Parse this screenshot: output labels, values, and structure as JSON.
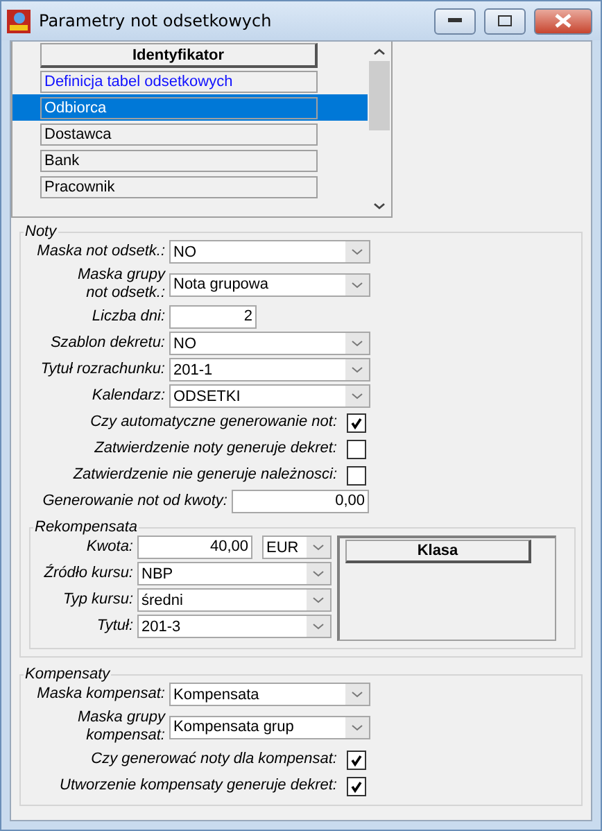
{
  "window": {
    "title": "Parametry not odsetkowych"
  },
  "list": {
    "header": "Identyfikator",
    "rows": [
      {
        "label": "Definicja tabel odsetkowych",
        "selected": false,
        "link": true
      },
      {
        "label": "Odbiorca",
        "selected": true,
        "link": false
      },
      {
        "label": "Dostawca",
        "selected": false,
        "link": false
      },
      {
        "label": "Bank",
        "selected": false,
        "link": false
      },
      {
        "label": "Pracownik",
        "selected": false,
        "link": false
      }
    ]
  },
  "noty": {
    "title": "Noty",
    "fields": [
      {
        "kind": "combo",
        "label": "Maska not odsetk.:",
        "value": "NO"
      },
      {
        "kind": "combo",
        "label": "Maska grupy\nnot odsetk.:",
        "value": "Nota grupowa"
      },
      {
        "kind": "number",
        "label": "Liczba dni:",
        "value": "2"
      },
      {
        "kind": "combo",
        "label": "Szablon dekretu:",
        "value": "NO"
      },
      {
        "kind": "combo",
        "label": "Tytuł rozrachunku:",
        "value": "201-1"
      },
      {
        "kind": "combo",
        "label": "Kalendarz:",
        "value": "ODSETKI"
      },
      {
        "kind": "checkbox",
        "label": "Czy automatyczne generowanie not:",
        "checked": true
      },
      {
        "kind": "checkbox",
        "label": "Zatwierdzenie noty generuje dekret:",
        "checked": false
      },
      {
        "kind": "checkbox",
        "label": "Zatwierdzenie nie generuje należnosci:",
        "checked": false
      },
      {
        "kind": "amount",
        "label": "Generowanie not od kwoty:",
        "value": "0,00"
      }
    ]
  },
  "rekompensata": {
    "title": "Rekompensata",
    "amount": {
      "label": "Kwota:",
      "value": "40,00",
      "currency": "EUR"
    },
    "fields": [
      {
        "kind": "combo",
        "label": "Źródło kursu:",
        "value": "NBP"
      },
      {
        "kind": "combo",
        "label": "Typ kursu:",
        "value": "średni"
      },
      {
        "kind": "combo",
        "label": "Tytuł:",
        "value": "201-3"
      }
    ],
    "table": {
      "header": "Klasa"
    }
  },
  "kompensaty": {
    "title": "Kompensaty",
    "fields": [
      {
        "kind": "combo",
        "label": "Maska kompensat:",
        "value": "Kompensata"
      },
      {
        "kind": "combo",
        "label": "Maska grupy\nkompensat:",
        "value": "Kompensata grup"
      },
      {
        "kind": "checkbox",
        "label": "Czy generować noty dla kompensat:",
        "checked": true
      },
      {
        "kind": "checkbox",
        "label": "Utworzenie kompensaty generuje dekret:",
        "checked": true
      }
    ]
  }
}
